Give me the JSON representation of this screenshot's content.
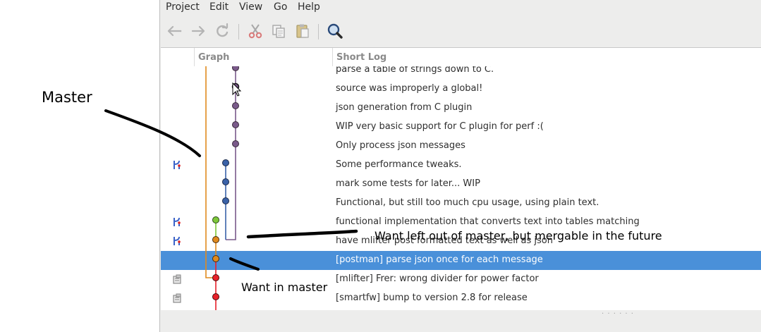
{
  "menubar": {
    "items": [
      "Project",
      "Edit",
      "View",
      "Go",
      "Help"
    ]
  },
  "toolbar": {
    "buttons": [
      "back-icon",
      "forward-icon",
      "refresh-icon",
      "cut-icon",
      "copy-icon",
      "paste-icon",
      "search-icon"
    ]
  },
  "columns": {
    "graph": "Graph",
    "short_log": "Short Log"
  },
  "commits": [
    {
      "message": "parse a table of strings down to C.",
      "icon": "none"
    },
    {
      "message": "source was improperly a global!",
      "icon": "none"
    },
    {
      "message": "json generation from C plugin",
      "icon": "none"
    },
    {
      "message": "WIP very basic support for C plugin for perf :(",
      "icon": "none"
    },
    {
      "message": "Only process json messages",
      "icon": "none"
    },
    {
      "message": "Some performance tweaks.",
      "icon": "branch-icon"
    },
    {
      "message": "mark some tests for later... WIP",
      "icon": "none"
    },
    {
      "message": "Functional, but still too much cpu usage, using plain text.",
      "icon": "none"
    },
    {
      "message": "functional implementation that converts text into tables matching",
      "icon": "branch-icon"
    },
    {
      "message": "have mlifter post formatted text as well as json",
      "icon": "branch-icon"
    },
    {
      "message": "[postman] parse json once for each message",
      "icon": "none",
      "selected": true
    },
    {
      "message": "[mlifter] Frer: wrong divider for power factor",
      "icon": "tag-icon"
    },
    {
      "message": "[smartfw] bump to version 2.8 for release",
      "icon": "tag-icon"
    }
  ],
  "annotations": {
    "master": "Master",
    "want_left_out": "Want left out of master, but mergable in the future",
    "want_in": "Want in master"
  },
  "colors": {
    "selection": "#4a90d9",
    "lane_orange": "#e08a1e",
    "lane_purple": "#7a5a8a",
    "lane_blue": "#3a62a8",
    "lane_green": "#7ec83a",
    "lane_red": "#e8202a"
  }
}
